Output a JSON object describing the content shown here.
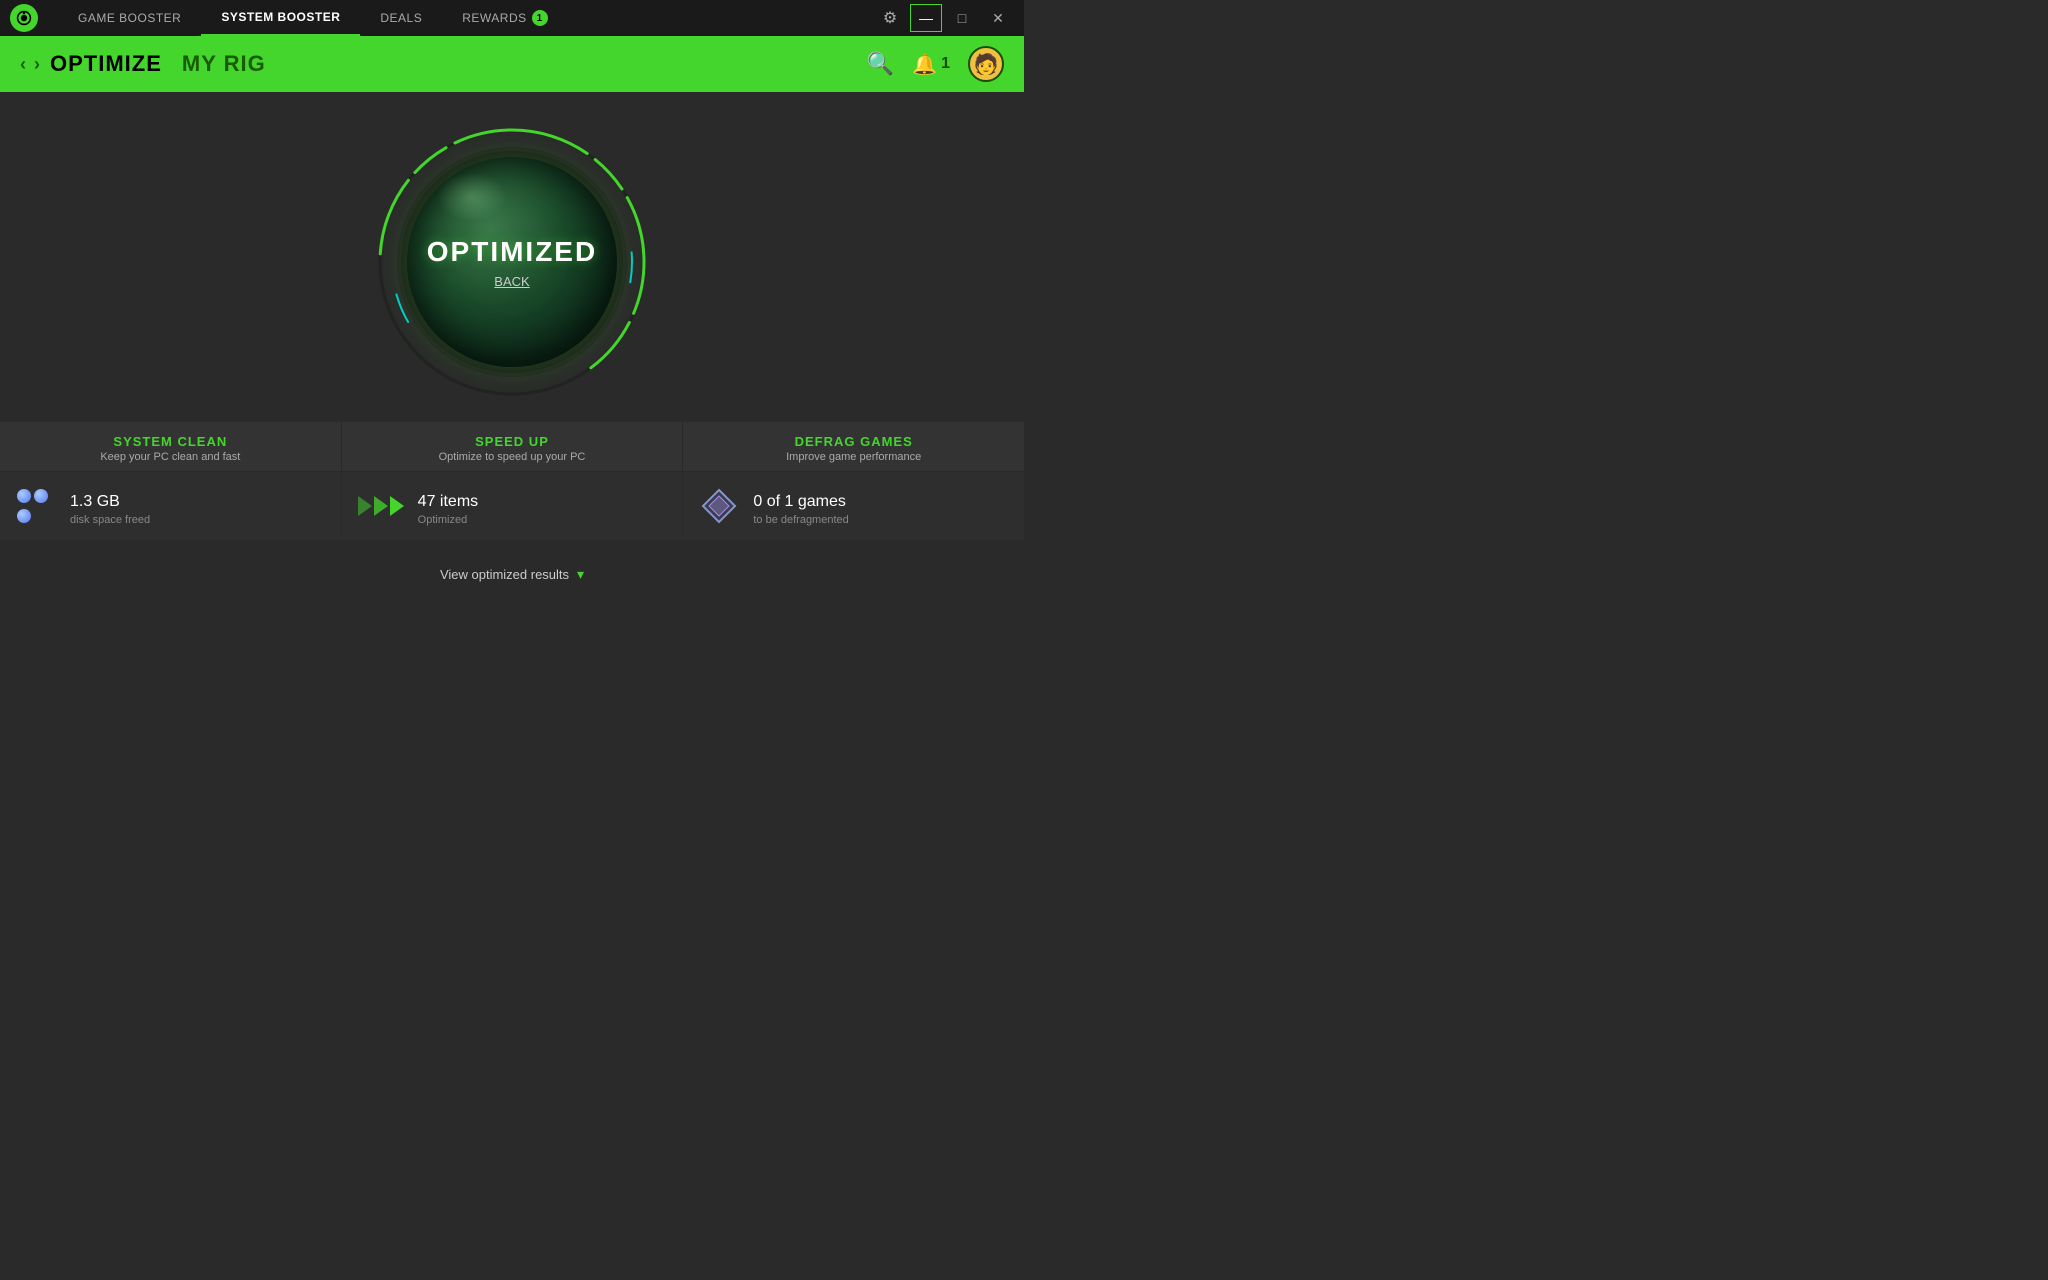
{
  "titleBar": {
    "tabs": [
      {
        "id": "game-booster",
        "label": "GAME BOOSTER",
        "active": false
      },
      {
        "id": "system-booster",
        "label": "SYSTEM BOOSTER",
        "active": true
      },
      {
        "id": "deals",
        "label": "DEALS",
        "active": false
      },
      {
        "id": "rewards",
        "label": "REWARDS",
        "active": false
      }
    ],
    "rewardsBadge": "1",
    "windowButtons": {
      "minimize": "—",
      "maximize": "□",
      "close": "✕"
    }
  },
  "subHeader": {
    "breadcrumbs": [
      {
        "label": "OPTIMIZE",
        "primary": true
      },
      {
        "label": "MY RIG",
        "primary": false
      }
    ],
    "notificationCount": "1"
  },
  "mainContent": {
    "centerLabel": "OPTIMIZED",
    "backLabel": "BACK"
  },
  "stats": {
    "cards": [
      {
        "title": "SYSTEM CLEAN",
        "subtitle": "Keep your PC clean and fast",
        "value": "1.3 GB",
        "desc": "disk space freed",
        "iconType": "bubbles"
      },
      {
        "title": "SPEED UP",
        "subtitle": "Optimize to speed up your PC",
        "value": "47",
        "valueUnit": " items",
        "desc": "Optimized",
        "iconType": "arrows"
      },
      {
        "title": "DEFRAG GAMES",
        "subtitle": "Improve game performance",
        "value": "0",
        "valueExtra": " of 1 games",
        "desc": "to be defragmented",
        "iconType": "diamond"
      }
    ],
    "viewResults": "View optimized results"
  },
  "colors": {
    "accent": "#44d62c",
    "bg": "#2a2a2a",
    "cardBg": "#333",
    "textPrimary": "#fff",
    "textSecondary": "#aaa"
  }
}
